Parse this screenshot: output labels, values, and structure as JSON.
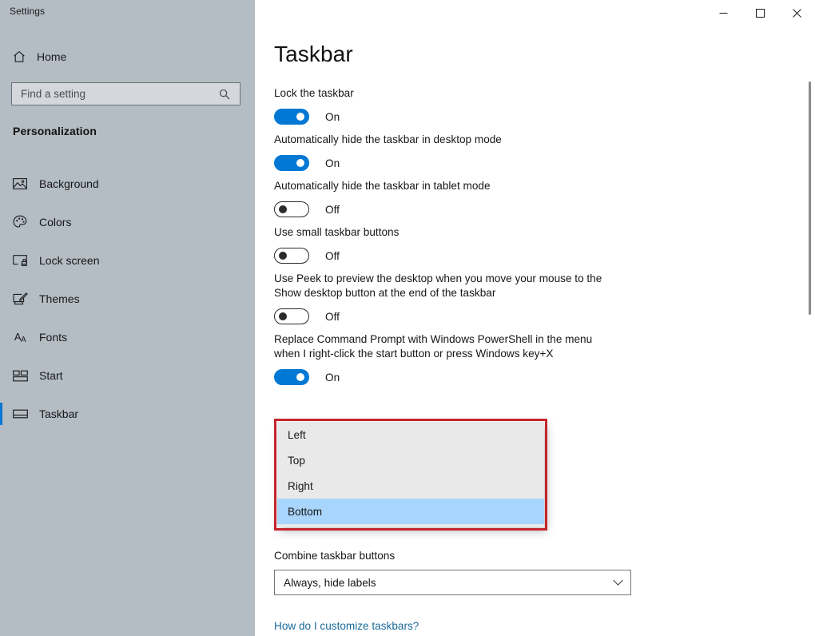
{
  "window": {
    "title": "Settings",
    "controls": [
      {
        "name": "minimize",
        "glyph": "minimize-icon"
      },
      {
        "name": "maximize",
        "glyph": "maximize-icon"
      },
      {
        "name": "close",
        "glyph": "close-icon"
      }
    ]
  },
  "sidebar": {
    "home_label": "Home",
    "home_icon": "home-icon",
    "search": {
      "placeholder": "Find a setting",
      "value": "",
      "icon": "search-icon"
    },
    "section_title": "Personalization",
    "items": [
      {
        "label": "Background",
        "icon": "image-icon",
        "selected": false
      },
      {
        "label": "Colors",
        "icon": "palette-icon",
        "selected": false
      },
      {
        "label": "Lock screen",
        "icon": "lock-screen-icon",
        "selected": false
      },
      {
        "label": "Themes",
        "icon": "themes-brush-icon",
        "selected": false
      },
      {
        "label": "Fonts",
        "icon": "fonts-aa-icon",
        "selected": false
      },
      {
        "label": "Start",
        "icon": "start-tiles-icon",
        "selected": false
      },
      {
        "label": "Taskbar",
        "icon": "taskbar-icon",
        "selected": true
      }
    ]
  },
  "main": {
    "page_title": "Taskbar",
    "settings": [
      {
        "label": "Lock the taskbar",
        "state": "On",
        "on": true
      },
      {
        "label": "Automatically hide the taskbar in desktop mode",
        "state": "On",
        "on": true
      },
      {
        "label": "Automatically hide the taskbar in tablet mode",
        "state": "Off",
        "on": false
      },
      {
        "label": "Use small taskbar buttons",
        "state": "Off",
        "on": false
      },
      {
        "label": "Use Peek to preview the desktop when you move your mouse to the Show desktop button at the end of the taskbar",
        "state": "Off",
        "on": false
      },
      {
        "label": "Replace Command Prompt with Windows PowerShell in the menu when I right-click the start button or press Windows key+X",
        "state": "On",
        "on": true
      }
    ],
    "open_dropdown": {
      "options": [
        "Left",
        "Top",
        "Right",
        "Bottom"
      ],
      "selected": "Bottom",
      "highlight_color": "#c5242c",
      "selection_color": "#a8d5fb"
    },
    "combine": {
      "label": "Combine taskbar buttons",
      "value": "Always, hide labels",
      "arrow_icon": "chevron-down-icon"
    },
    "help_link": "How do I customize taskbars?"
  },
  "colors": {
    "accent": "#0078d4",
    "sidebar_bg": "#b4bcc4",
    "link": "#1a6a9a",
    "highlight_red": "#c5242c"
  }
}
